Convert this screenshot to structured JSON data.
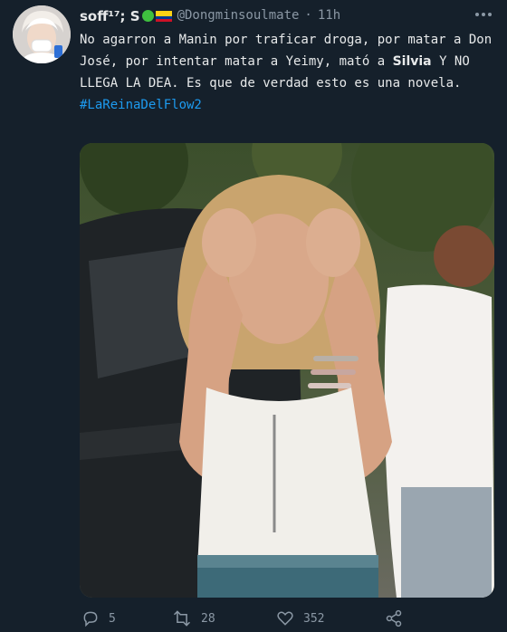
{
  "tweet": {
    "display_name": "soff¹⁷; S",
    "handle": "@Dongminsoulmate",
    "separator": "·",
    "time": "11h",
    "text_part1": "No agarron a Manin por traficar droga, por matar a Don José, por intentar matar a Yeimy, mató a ",
    "text_bold": "Silvia",
    "text_part2": " Y NO LLEGA LA DEA. Es que de verdad esto es una novela.",
    "hashtag": "#LaReinaDelFlow2"
  },
  "actions": {
    "reply_count": "5",
    "retweet_count": "28",
    "like_count": "352"
  },
  "colors": {
    "background": "#15202b",
    "text": "#e7e9ea",
    "muted": "#8b98a5",
    "link": "#1d9bf0"
  },
  "icons": {
    "more": "more-dots-icon",
    "reply": "reply-icon",
    "retweet": "retweet-icon",
    "like": "heart-icon",
    "share": "share-icon"
  }
}
